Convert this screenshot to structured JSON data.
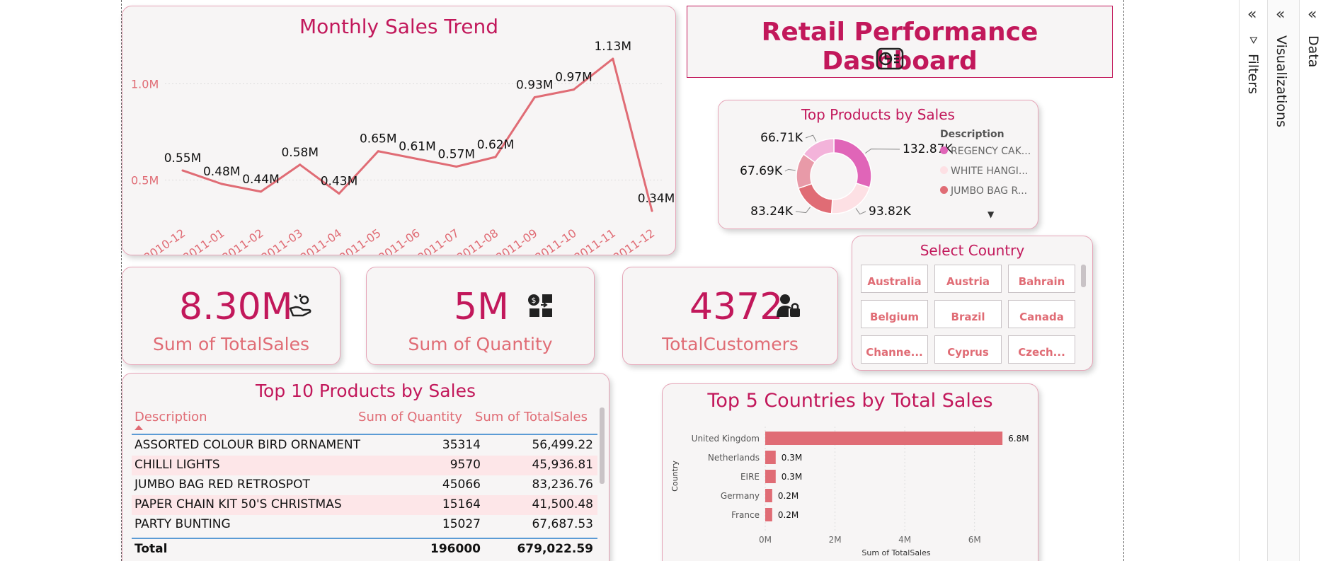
{
  "dashboard": {
    "title": "Retail Performance Dashboard"
  },
  "line_chart": {
    "title": "Monthly Sales Trend"
  },
  "donut_chart": {
    "title": "Top Products by Sales",
    "legend_title": "Description",
    "legend": [
      "REGENCY CAK...",
      "WHITE HANGI...",
      "JUMBO BAG R..."
    ]
  },
  "kpis": {
    "total_sales": {
      "value": "8.30M",
      "label": "Sum of TotalSales"
    },
    "quantity": {
      "value": "5M",
      "label": "Sum of Quantity"
    },
    "customers": {
      "value": "4372",
      "label": "TotalCustomers"
    }
  },
  "country_slicer": {
    "title": "Select Country",
    "options": [
      "Australia",
      "Austria",
      "Bahrain",
      "Belgium",
      "Brazil",
      "Canada",
      "Channe...",
      "Cyprus",
      "Czech..."
    ]
  },
  "top_products_table": {
    "title": "Top 10 Products by Sales",
    "headers": [
      "Description",
      "Sum of Quantity",
      "Sum of TotalSales"
    ],
    "rows": [
      [
        "ASSORTED COLOUR BIRD ORNAMENT",
        "35314",
        "56,499.22"
      ],
      [
        "CHILLI LIGHTS",
        "9570",
        "45,936.81"
      ],
      [
        "JUMBO BAG RED RETROSPOT",
        "45066",
        "83,236.76"
      ],
      [
        "PAPER CHAIN KIT 50'S CHRISTMAS",
        "15164",
        "41,500.48"
      ],
      [
        "PARTY BUNTING",
        "15027",
        "67,687.53"
      ]
    ],
    "total": [
      "Total",
      "196000",
      "679,022.59"
    ]
  },
  "bar_chart": {
    "title": "Top 5 Countries by Total Sales"
  },
  "side_panes": {
    "filters": "Filters",
    "visualizations": "Visualizations",
    "data": "Data"
  },
  "colors": {
    "accent": "#c2185b",
    "line": "#e06c75",
    "card_bg": "#f7f5f5"
  },
  "chart_data": [
    {
      "type": "line",
      "title": "Monthly Sales Trend",
      "x": [
        "2010-12",
        "2011-01",
        "2011-02",
        "2011-03",
        "2011-04",
        "2011-05",
        "2011-06",
        "2011-07",
        "2011-08",
        "2011-09",
        "2011-10",
        "2011-11",
        "2011-12"
      ],
      "values": [
        0.55,
        0.48,
        0.44,
        0.58,
        0.43,
        0.65,
        0.61,
        0.57,
        0.62,
        0.93,
        0.97,
        1.13,
        0.34
      ],
      "labels": [
        "0.55M",
        "0.48M",
        "0.44M",
        "0.58M",
        "0.43M",
        "0.65M",
        "0.61M",
        "0.57M",
        "0.62M",
        "0.93M",
        "0.97M",
        "1.13M",
        "0.34M"
      ],
      "y_ticks": [
        0.5,
        1.0
      ],
      "y_tick_labels": [
        "0.5M",
        "1.0M"
      ],
      "ylim": [
        0.3,
        1.2
      ],
      "grid": true
    },
    {
      "type": "pie",
      "title": "Top Products by Sales",
      "values": [
        132.87,
        93.82,
        83.24,
        67.69,
        66.71
      ],
      "labels": [
        "132.87K",
        "93.82K",
        "83.24K",
        "67.69K",
        "66.71K"
      ],
      "colors": [
        "#e065b8",
        "#fde0e4",
        "#e06c75",
        "#e89aa8",
        "#f3b3da"
      ]
    },
    {
      "type": "bar",
      "title": "Top 5 Countries by Total Sales",
      "categories": [
        "United Kingdom",
        "Netherlands",
        "EIRE",
        "Germany",
        "France"
      ],
      "values": [
        6.8,
        0.3,
        0.3,
        0.2,
        0.2
      ],
      "labels": [
        "6.8M",
        "0.3M",
        "0.3M",
        "0.2M",
        "0.2M"
      ],
      "xlabel": "Sum of TotalSales",
      "ylabel": "Country",
      "x_ticks": [
        0,
        2,
        4,
        6
      ],
      "x_tick_labels": [
        "0M",
        "2M",
        "4M",
        "6M"
      ],
      "xlim": [
        0,
        7
      ],
      "grid": true
    }
  ]
}
